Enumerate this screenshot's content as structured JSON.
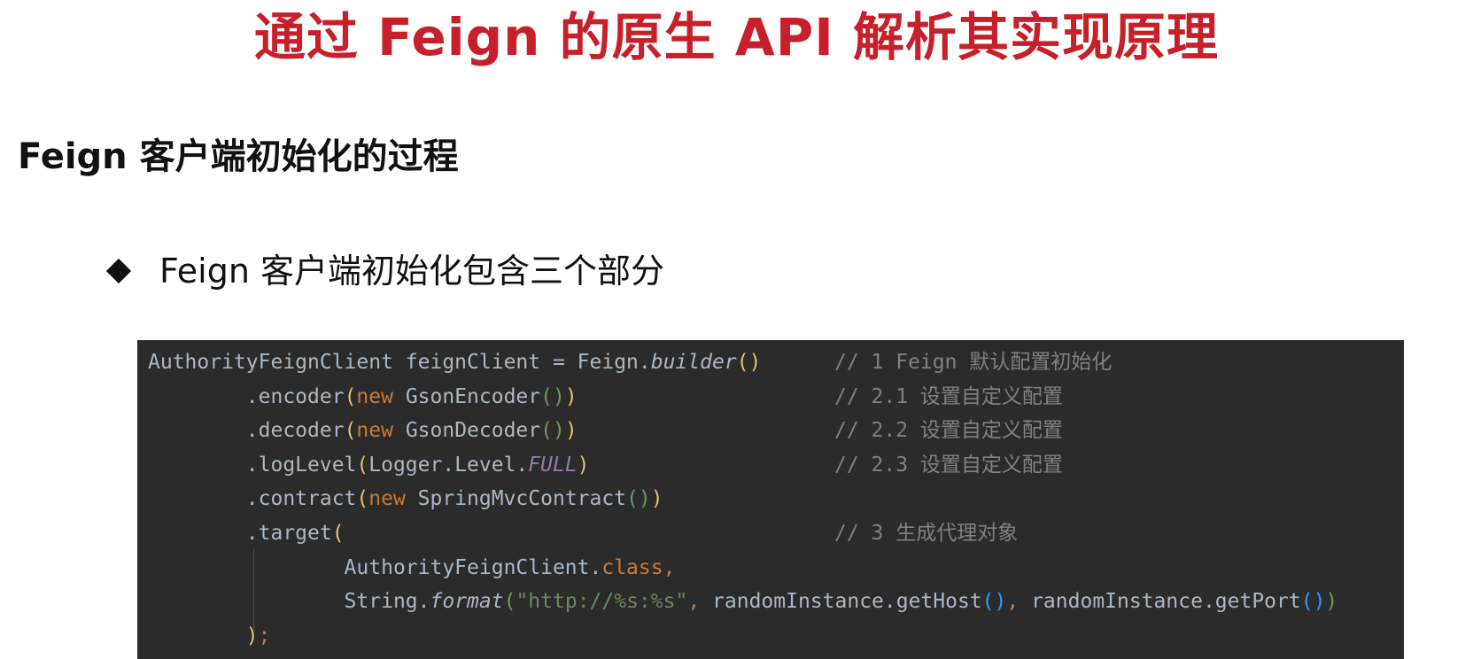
{
  "slide": {
    "title": "通过 Feign 的原生 API 解析其实现原理",
    "section_heading": "Feign 客户端初始化的过程",
    "bullet": "Feign 客户端初始化包含三个部分"
  },
  "code": {
    "lines": [
      {
        "tokens": [
          {
            "text": "AuthorityFeignClient feignClient = Feign.",
            "style": "plain"
          },
          {
            "text": "builder",
            "style": "it"
          },
          {
            "text": "()",
            "style": "pY"
          }
        ],
        "comment": "// 1 Feign 默认配置初始化"
      },
      {
        "tokens": [
          {
            "text": "        .encoder",
            "style": "plain"
          },
          {
            "text": "(",
            "style": "pY"
          },
          {
            "text": "new ",
            "style": "kw"
          },
          {
            "text": "GsonEncoder",
            "style": "plain"
          },
          {
            "text": "()",
            "style": "pG"
          },
          {
            "text": ")",
            "style": "pY"
          }
        ],
        "comment": "// 2.1 设置自定义配置"
      },
      {
        "tokens": [
          {
            "text": "        .decoder",
            "style": "plain"
          },
          {
            "text": "(",
            "style": "pY"
          },
          {
            "text": "new ",
            "style": "kw"
          },
          {
            "text": "GsonDecoder",
            "style": "plain"
          },
          {
            "text": "()",
            "style": "pG"
          },
          {
            "text": ")",
            "style": "pY"
          }
        ],
        "comment": "// 2.2 设置自定义配置"
      },
      {
        "tokens": [
          {
            "text": "        .logLevel",
            "style": "plain"
          },
          {
            "text": "(",
            "style": "pY"
          },
          {
            "text": "Logger.Level.",
            "style": "plain"
          },
          {
            "text": "FULL",
            "style": "const"
          },
          {
            "text": ")",
            "style": "pY"
          }
        ],
        "comment": "// 2.3 设置自定义配置"
      },
      {
        "tokens": [
          {
            "text": "        .contract",
            "style": "plain"
          },
          {
            "text": "(",
            "style": "pY"
          },
          {
            "text": "new ",
            "style": "kw"
          },
          {
            "text": "SpringMvcContract",
            "style": "plain"
          },
          {
            "text": "()",
            "style": "pG"
          },
          {
            "text": ")",
            "style": "pY"
          }
        ],
        "comment": ""
      },
      {
        "tokens": [
          {
            "text": "        .target",
            "style": "plain"
          },
          {
            "text": "(",
            "style": "pY"
          }
        ],
        "comment": "// 3 生成代理对象"
      },
      {
        "tokens": [
          {
            "text": "                AuthorityFeignClient.",
            "style": "plain"
          },
          {
            "text": "class",
            "style": "kw"
          },
          {
            "text": ",",
            "style": "kw"
          }
        ],
        "comment": ""
      },
      {
        "tokens": [
          {
            "text": "                String.",
            "style": "plain"
          },
          {
            "text": "format",
            "style": "it"
          },
          {
            "text": "(",
            "style": "pG"
          },
          {
            "text": "\"http://%s:%s\"",
            "style": "str"
          },
          {
            "text": ", ",
            "style": "kw"
          },
          {
            "text": "randomInstance.getHost",
            "style": "plain"
          },
          {
            "text": "()",
            "style": "pB"
          },
          {
            "text": ", ",
            "style": "kw"
          },
          {
            "text": "randomInstance.getPort",
            "style": "plain"
          },
          {
            "text": "()",
            "style": "pB"
          },
          {
            "text": ")",
            "style": "pG"
          }
        ],
        "comment": ""
      },
      {
        "tokens": [
          {
            "text": "        ",
            "style": "plain"
          },
          {
            "text": ")",
            "style": "pY"
          },
          {
            "text": ";",
            "style": "kw"
          }
        ],
        "comment": ""
      }
    ]
  }
}
